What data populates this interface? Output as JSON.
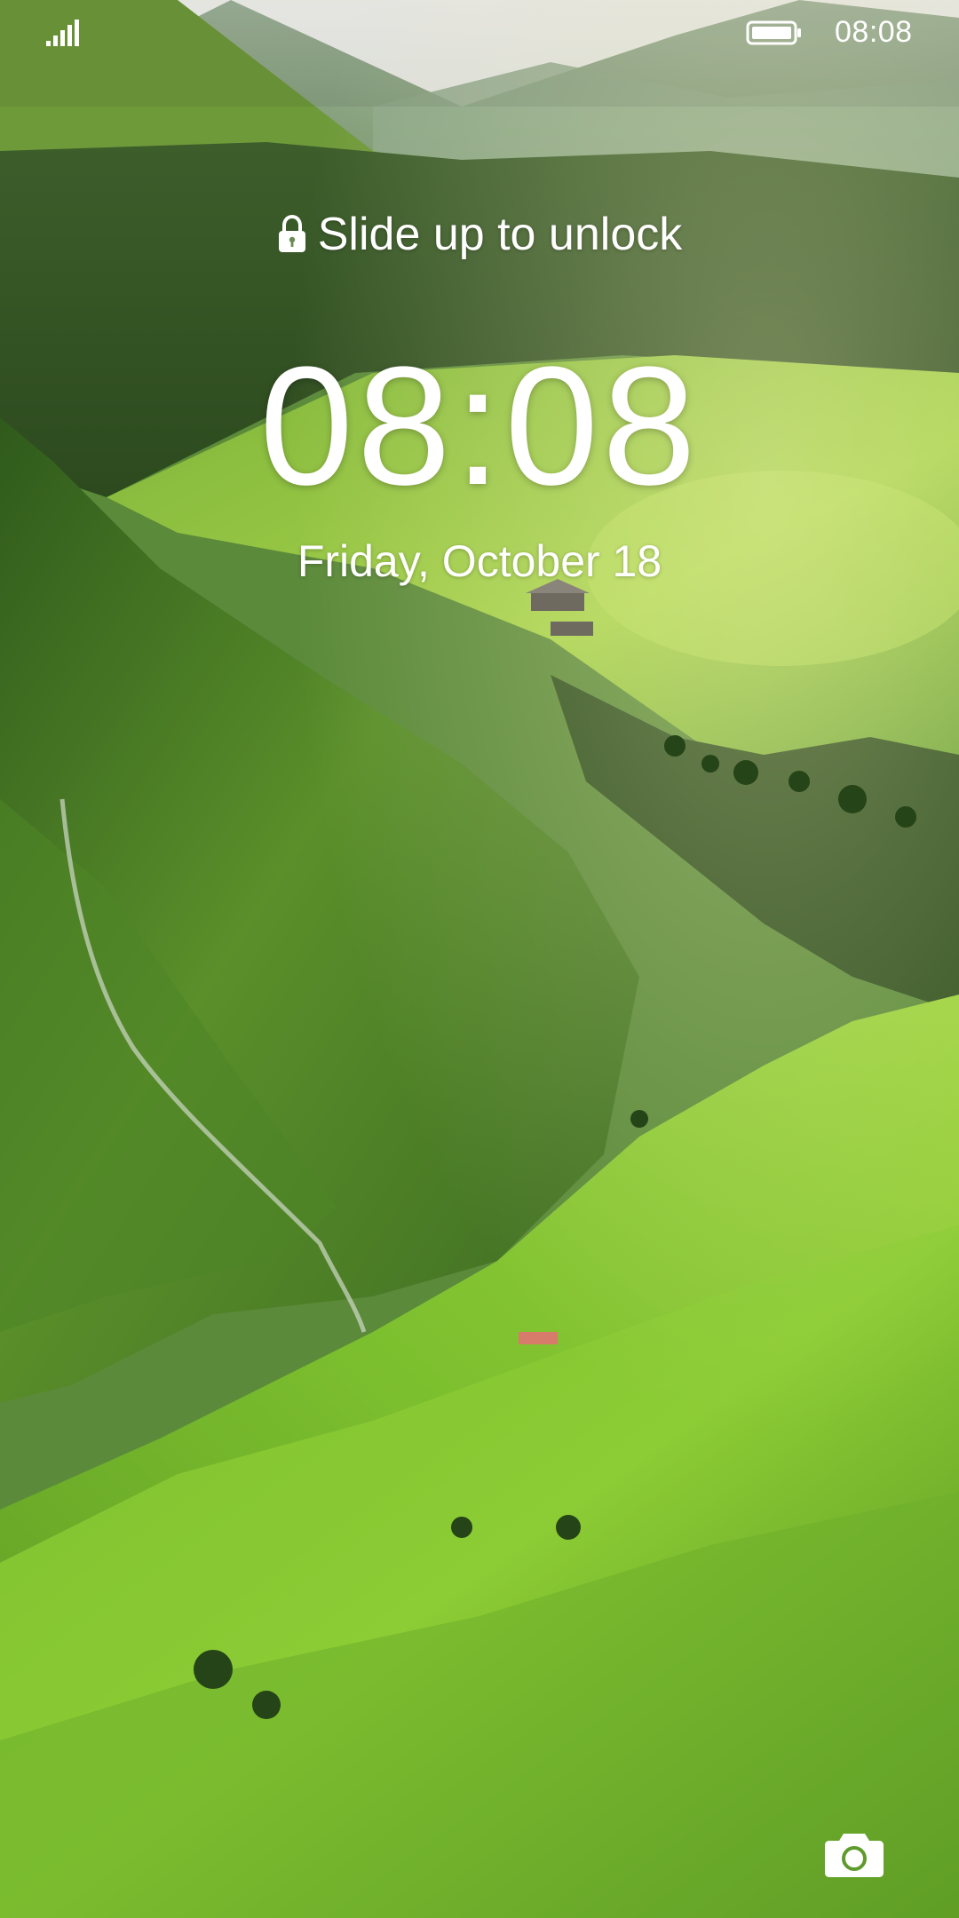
{
  "status_bar": {
    "time": "08:08",
    "signal_icon": "signal-bars-icon",
    "battery_icon": "battery-full-icon"
  },
  "lock_screen": {
    "unlock_hint": "Slide up to unlock",
    "lock_icon": "lock-icon",
    "clock": "08:08",
    "date": "Friday, October 18",
    "camera_icon": "camera-icon"
  },
  "wallpaper": {
    "subject": "green alpine valley",
    "sky_color": "#e9ece6",
    "grass_light": "#8fcf3a",
    "grass_dark": "#2f5a1c"
  }
}
